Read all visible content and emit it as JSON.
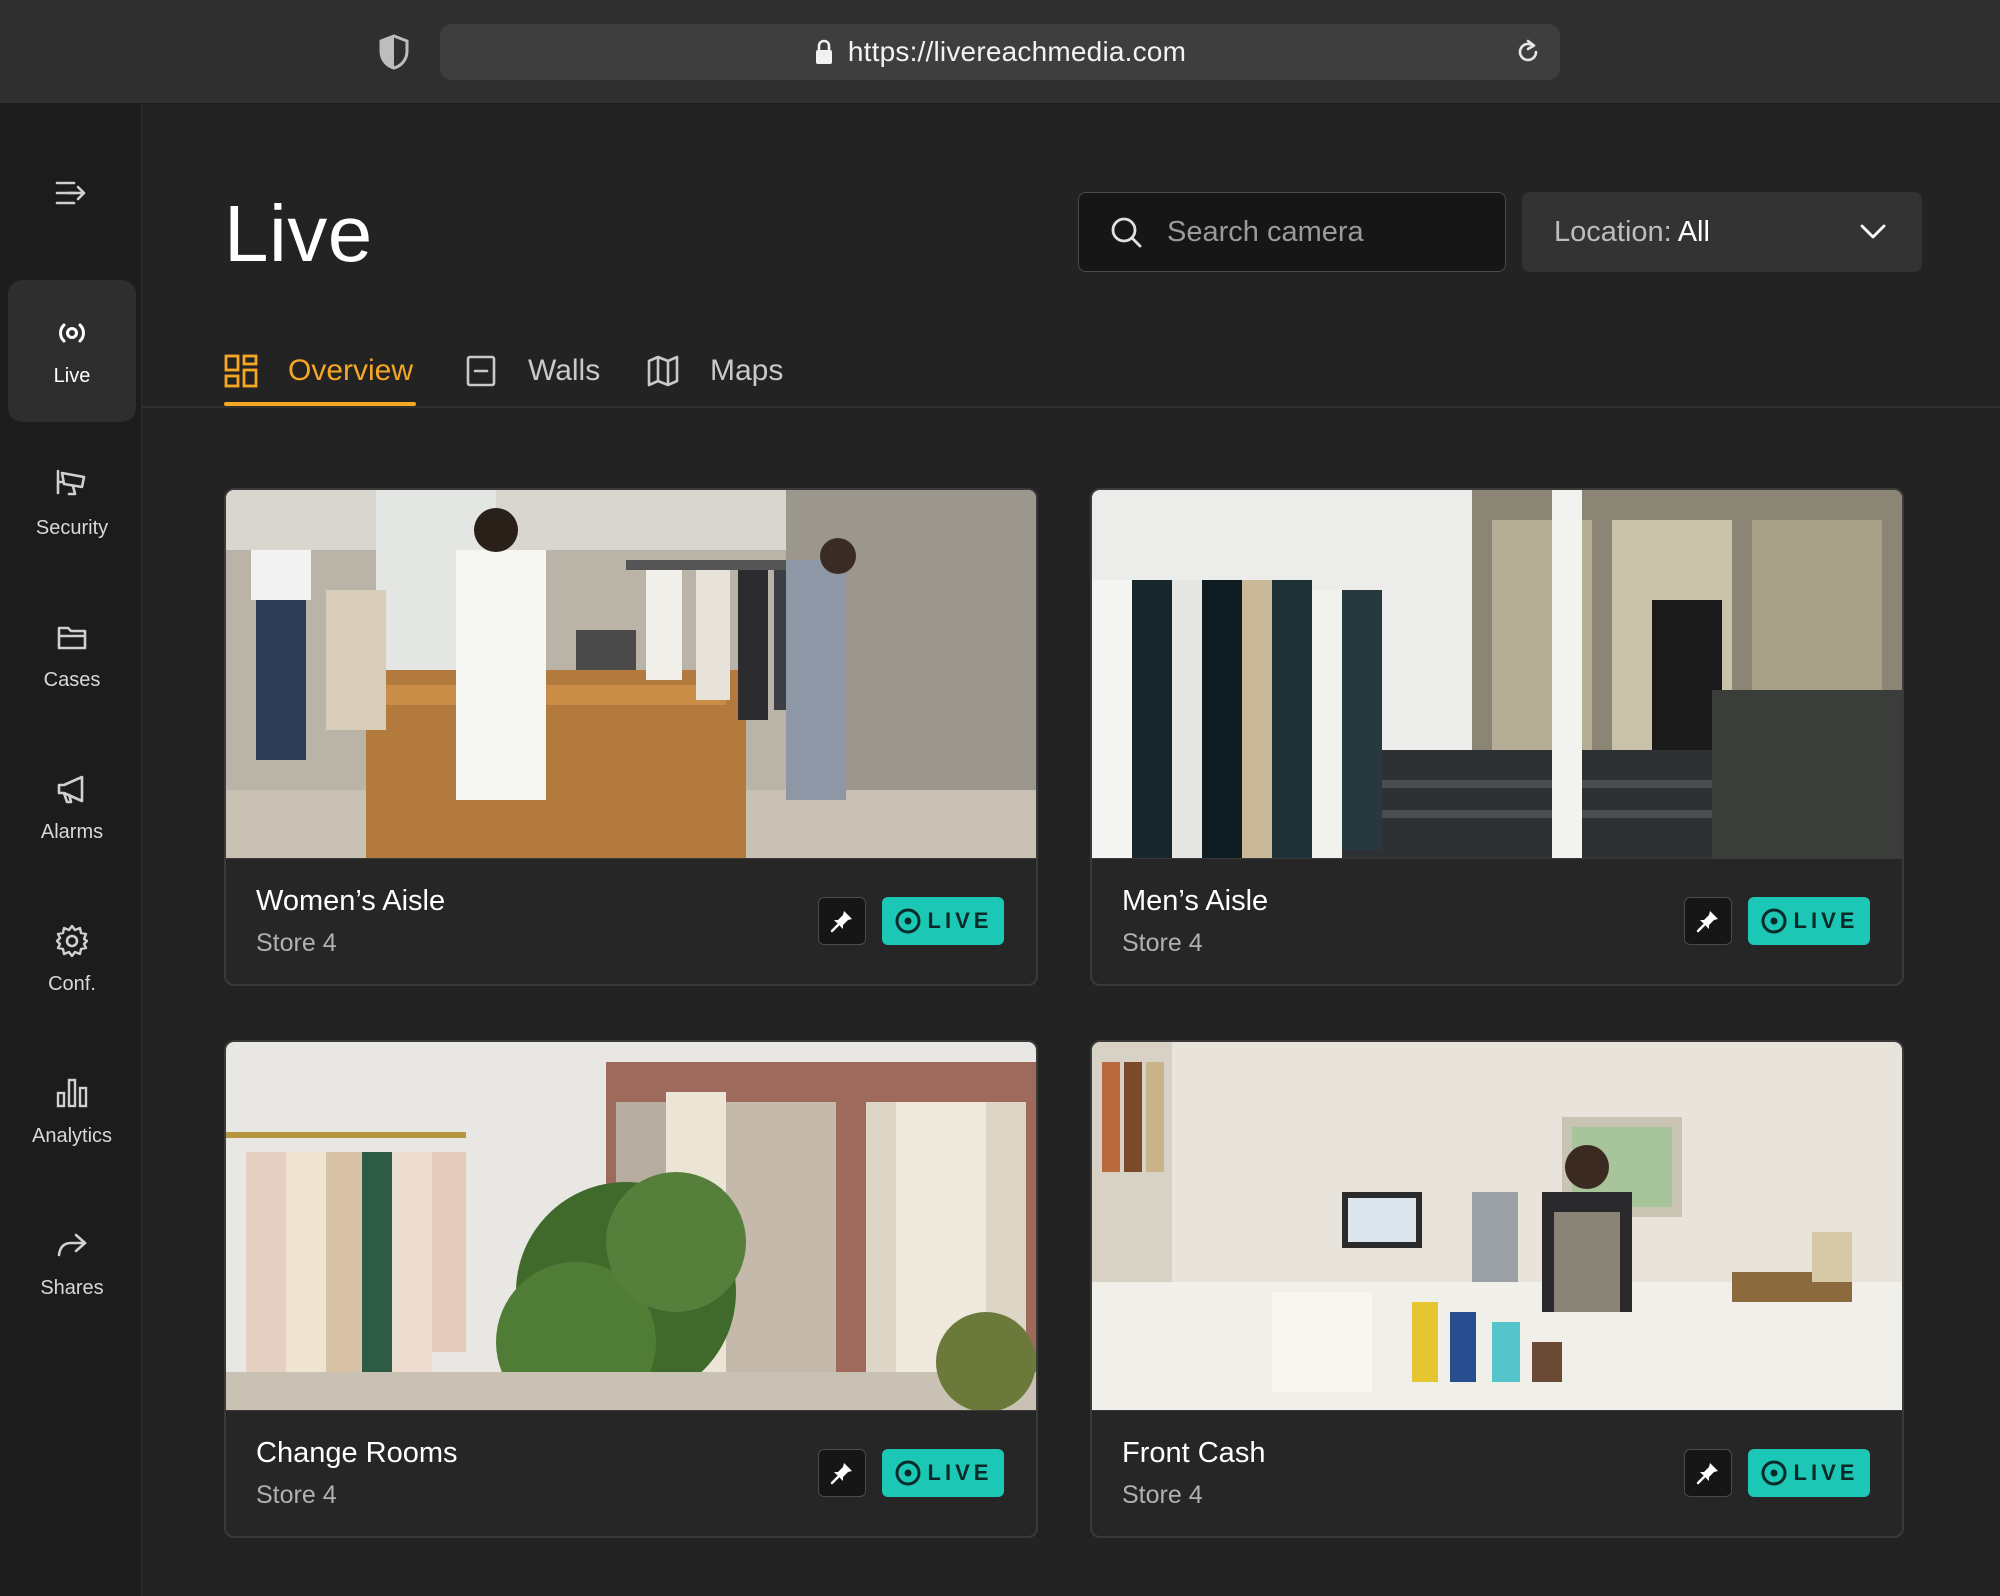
{
  "browser": {
    "url": "https://livereachmedia.com"
  },
  "sidebar": {
    "items": [
      {
        "label": "Live",
        "icon": "live-icon",
        "active": true
      },
      {
        "label": "Security",
        "icon": "security-camera-icon"
      },
      {
        "label": "Cases",
        "icon": "folder-icon"
      },
      {
        "label": "Alarms",
        "icon": "megaphone-icon"
      },
      {
        "label": "Conf.",
        "icon": "gear-icon"
      },
      {
        "label": "Analytics",
        "icon": "bar-chart-icon"
      },
      {
        "label": "Shares",
        "icon": "share-icon"
      }
    ]
  },
  "header": {
    "title": "Live",
    "search_placeholder": "Search camera",
    "location_label": "Location:",
    "location_value": "All"
  },
  "tabs": [
    {
      "label": "Overview",
      "icon": "grid-icon",
      "active": true
    },
    {
      "label": "Walls",
      "icon": "wall-icon"
    },
    {
      "label": "Maps",
      "icon": "map-icon"
    }
  ],
  "cameras": [
    {
      "name": "Women’s Aisle",
      "store": "Store 4",
      "badge": "LIVE"
    },
    {
      "name": "Men’s Aisle",
      "store": "Store 4",
      "badge": "LIVE"
    },
    {
      "name": "Change Rooms",
      "store": "Store 4",
      "badge": "LIVE"
    },
    {
      "name": "Front Cash",
      "store": "Store 4",
      "badge": "LIVE"
    }
  ],
  "colors": {
    "accent": "#f5a623",
    "live_badge": "#1cc7b5",
    "background": "#232323",
    "sidebar": "#1c1c1c"
  }
}
